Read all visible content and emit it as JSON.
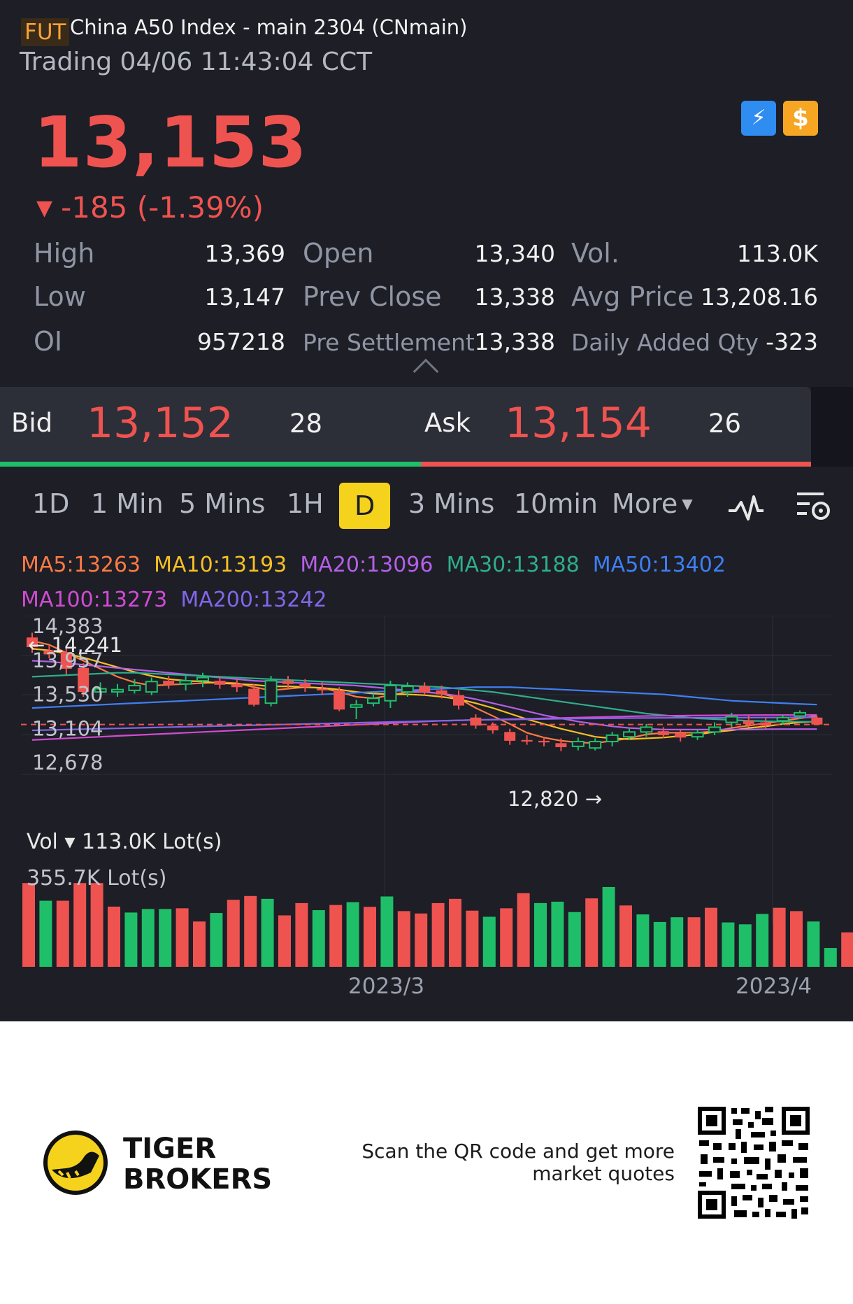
{
  "header": {
    "fut_tag": "FUT",
    "title": "China A50 Index - main 2304 (CNmain)",
    "status": "Trading 04/06 11:43:04 CCT",
    "price": "13,153",
    "change_arrow": "▼",
    "change": "-185 (-1.39%)",
    "badge_lightning": "⚡",
    "badge_dollar": "$"
  },
  "stats": {
    "high_label": "High",
    "high": "13,369",
    "low_label": "Low",
    "low": "13,147",
    "oi_label": "OI",
    "oi": "957218",
    "open_label": "Open",
    "open": "13,340",
    "prev_close_label": "Prev Close",
    "prev_close": "13,338",
    "pre_settlement_label": "Pre Settlement",
    "pre_settlement": "13,338",
    "vol_label": "Vol.",
    "vol": "113.0K",
    "avg_price_label": "Avg Price",
    "avg_price": "13,208.16",
    "daily_added_label": "Daily Added Qty",
    "daily_added": "-323"
  },
  "quote": {
    "bid_label": "Bid",
    "bid_price": "13,152",
    "bid_qty": "28",
    "ask_label": "Ask",
    "ask_price": "13,154",
    "ask_qty": "26"
  },
  "periods": [
    "1D",
    "1 Min",
    "5 Mins",
    "1H",
    "D",
    "3 Mins",
    "10min",
    "More"
  ],
  "active_period": "D",
  "ma": [
    {
      "label": "MA5:13263",
      "color": "#ff7a45"
    },
    {
      "label": "MA10:13193",
      "color": "#f6c025"
    },
    {
      "label": "MA20:13096",
      "color": "#b460e8"
    },
    {
      "label": "MA30:13188",
      "color": "#2fae8c"
    },
    {
      "label": "MA50:13402",
      "color": "#3f7ff5"
    },
    {
      "label": "MA100:13273",
      "color": "#d24bd3"
    },
    {
      "label": "MA200:13242",
      "color": "#8266e8"
    }
  ],
  "chart": {
    "y_ticks": [
      "14,383",
      "13,957",
      "13,530",
      "13,104",
      "12,678"
    ],
    "max_label": "← 14,241",
    "min_label": "12,820 →",
    "volume_title": "Vol ▾ 113.0K Lot(s)",
    "volume_max": "355.7K Lot(s)",
    "x_ticks": [
      "2023/3",
      "2023/4"
    ]
  },
  "chart_data": {
    "type": "candlestick",
    "y_range": [
      12678,
      14383
    ],
    "current_price": 13153,
    "candles": [
      {
        "o": 14241,
        "c": 14120,
        "h": 14300,
        "l": 14050
      },
      {
        "o": 14080,
        "c": 14030,
        "h": 14150,
        "l": 13980
      },
      {
        "o": 14060,
        "c": 13850,
        "h": 14120,
        "l": 13780
      },
      {
        "o": 13860,
        "c": 13560,
        "h": 13920,
        "l": 13500
      },
      {
        "o": 13560,
        "c": 13600,
        "h": 13680,
        "l": 13480
      },
      {
        "o": 13560,
        "c": 13590,
        "h": 13660,
        "l": 13500
      },
      {
        "o": 13580,
        "c": 13640,
        "h": 13720,
        "l": 13540
      },
      {
        "o": 13560,
        "c": 13690,
        "h": 13740,
        "l": 13520
      },
      {
        "o": 13700,
        "c": 13650,
        "h": 13760,
        "l": 13600
      },
      {
        "o": 13660,
        "c": 13700,
        "h": 13760,
        "l": 13580
      },
      {
        "o": 13700,
        "c": 13740,
        "h": 13800,
        "l": 13620
      },
      {
        "o": 13700,
        "c": 13650,
        "h": 13760,
        "l": 13600
      },
      {
        "o": 13660,
        "c": 13620,
        "h": 13720,
        "l": 13560
      },
      {
        "o": 13600,
        "c": 13400,
        "h": 13660,
        "l": 13380
      },
      {
        "o": 13420,
        "c": 13700,
        "h": 13760,
        "l": 13380
      },
      {
        "o": 13700,
        "c": 13660,
        "h": 13760,
        "l": 13600
      },
      {
        "o": 13660,
        "c": 13620,
        "h": 13720,
        "l": 13560
      },
      {
        "o": 13600,
        "c": 13580,
        "h": 13680,
        "l": 13520
      },
      {
        "o": 13580,
        "c": 13340,
        "h": 13620,
        "l": 13320
      },
      {
        "o": 13370,
        "c": 13400,
        "h": 13460,
        "l": 13220
      },
      {
        "o": 13420,
        "c": 13480,
        "h": 13540,
        "l": 13380
      },
      {
        "o": 13450,
        "c": 13640,
        "h": 13700,
        "l": 13360
      },
      {
        "o": 13560,
        "c": 13630,
        "h": 13680,
        "l": 13500
      },
      {
        "o": 13630,
        "c": 13560,
        "h": 13680,
        "l": 13520
      },
      {
        "o": 13580,
        "c": 13530,
        "h": 13640,
        "l": 13480
      },
      {
        "o": 13520,
        "c": 13390,
        "h": 13580,
        "l": 13340
      },
      {
        "o": 13240,
        "c": 13140,
        "h": 13280,
        "l": 13100
      },
      {
        "o": 13140,
        "c": 13080,
        "h": 13180,
        "l": 13040
      },
      {
        "o": 13060,
        "c": 12950,
        "h": 13100,
        "l": 12900
      },
      {
        "o": 12960,
        "c": 12940,
        "h": 13020,
        "l": 12900
      },
      {
        "o": 12950,
        "c": 12930,
        "h": 13000,
        "l": 12880
      },
      {
        "o": 12920,
        "c": 12870,
        "h": 12980,
        "l": 12820
      },
      {
        "o": 12880,
        "c": 12940,
        "h": 12990,
        "l": 12830
      },
      {
        "o": 12860,
        "c": 12940,
        "h": 12980,
        "l": 12830
      },
      {
        "o": 12940,
        "c": 13020,
        "h": 13060,
        "l": 12880
      },
      {
        "o": 13000,
        "c": 13060,
        "h": 13100,
        "l": 12960
      },
      {
        "o": 13060,
        "c": 13120,
        "h": 13160,
        "l": 13000
      },
      {
        "o": 13070,
        "c": 13020,
        "h": 13120,
        "l": 12980
      },
      {
        "o": 13040,
        "c": 12990,
        "h": 13090,
        "l": 12940
      },
      {
        "o": 13000,
        "c": 13050,
        "h": 13090,
        "l": 12960
      },
      {
        "o": 13060,
        "c": 13120,
        "h": 13180,
        "l": 13020
      },
      {
        "o": 13180,
        "c": 13250,
        "h": 13300,
        "l": 13120
      },
      {
        "o": 13200,
        "c": 13160,
        "h": 13260,
        "l": 13120
      },
      {
        "o": 13180,
        "c": 13140,
        "h": 13240,
        "l": 13100
      },
      {
        "o": 13200,
        "c": 13240,
        "h": 13270,
        "l": 13150
      },
      {
        "o": 13260,
        "c": 13300,
        "h": 13330,
        "l": 13220
      },
      {
        "o": 13240,
        "c": 13153,
        "h": 13260,
        "l": 13147
      }
    ],
    "volume_max": 355.7,
    "volumes": [
      {
        "v": 355,
        "d": "down"
      },
      {
        "v": 280,
        "d": "up"
      },
      {
        "v": 280,
        "d": "down"
      },
      {
        "v": 355,
        "d": "down"
      },
      {
        "v": 355,
        "d": "down"
      },
      {
        "v": 255,
        "d": "down"
      },
      {
        "v": 230,
        "d": "up"
      },
      {
        "v": 245,
        "d": "up"
      },
      {
        "v": 245,
        "d": "up"
      },
      {
        "v": 248,
        "d": "down"
      },
      {
        "v": 192,
        "d": "down"
      },
      {
        "v": 228,
        "d": "up"
      },
      {
        "v": 284,
        "d": "down"
      },
      {
        "v": 300,
        "d": "down"
      },
      {
        "v": 288,
        "d": "up"
      },
      {
        "v": 218,
        "d": "down"
      },
      {
        "v": 270,
        "d": "down"
      },
      {
        "v": 240,
        "d": "up"
      },
      {
        "v": 262,
        "d": "down"
      },
      {
        "v": 274,
        "d": "up"
      },
      {
        "v": 254,
        "d": "down"
      },
      {
        "v": 298,
        "d": "up"
      },
      {
        "v": 236,
        "d": "down"
      },
      {
        "v": 226,
        "d": "down"
      },
      {
        "v": 270,
        "d": "down"
      },
      {
        "v": 288,
        "d": "down"
      },
      {
        "v": 238,
        "d": "down"
      },
      {
        "v": 212,
        "d": "up"
      },
      {
        "v": 248,
        "d": "down"
      },
      {
        "v": 312,
        "d": "down"
      },
      {
        "v": 270,
        "d": "up"
      },
      {
        "v": 276,
        "d": "up"
      },
      {
        "v": 232,
        "d": "up"
      },
      {
        "v": 290,
        "d": "down"
      },
      {
        "v": 338,
        "d": "up"
      },
      {
        "v": 260,
        "d": "down"
      },
      {
        "v": 222,
        "d": "up"
      },
      {
        "v": 190,
        "d": "up"
      },
      {
        "v": 210,
        "d": "up"
      },
      {
        "v": 210,
        "d": "down"
      },
      {
        "v": 250,
        "d": "down"
      },
      {
        "v": 188,
        "d": "up"
      },
      {
        "v": 180,
        "d": "up"
      },
      {
        "v": 224,
        "d": "up"
      },
      {
        "v": 250,
        "d": "down"
      },
      {
        "v": 236,
        "d": "down"
      },
      {
        "v": 192,
        "d": "up"
      },
      {
        "v": 80,
        "d": "up"
      },
      {
        "v": 146,
        "d": "down"
      }
    ],
    "ma_lines": [
      {
        "name": "MA5",
        "values": [
          14200,
          14150,
          14050,
          13950,
          13850,
          13750,
          13680,
          13640,
          13650,
          13660,
          13670,
          13680,
          13670,
          13620,
          13580,
          13600,
          13620,
          13610,
          13560,
          13500,
          13480,
          13520,
          13560,
          13560,
          13540,
          13480,
          13360,
          13260,
          13160,
          13050,
          12990,
          12950,
          12930,
          12920,
          12950,
          12980,
          13030,
          13050,
          13050,
          13050,
          13070,
          13110,
          13140,
          13170,
          13200,
          13230,
          13263
        ]
      },
      {
        "name": "MA10",
        "values": [
          14100,
          14080,
          14040,
          13990,
          13930,
          13870,
          13810,
          13760,
          13720,
          13700,
          13690,
          13670,
          13660,
          13650,
          13630,
          13630,
          13620,
          13610,
          13590,
          13560,
          13540,
          13530,
          13530,
          13520,
          13500,
          13470,
          13420,
          13360,
          13290,
          13220,
          13160,
          13100,
          13050,
          13000,
          12980,
          12970,
          12980,
          12990,
          13010,
          13030,
          13060,
          13080,
          13110,
          13130,
          13160,
          13180,
          13193
        ]
      },
      {
        "name": "MA20",
        "values": [
          13950,
          13940,
          13920,
          13900,
          13880,
          13860,
          13840,
          13820,
          13800,
          13780,
          13760,
          13740,
          13720,
          13700,
          13690,
          13680,
          13670,
          13660,
          13650,
          13640,
          13620,
          13600,
          13580,
          13560,
          13540,
          13510,
          13470,
          13420,
          13370,
          13320,
          13270,
          13230,
          13190,
          13160,
          13130,
          13110,
          13100,
          13090,
          13090,
          13090,
          13090,
          13090,
          13090,
          13095,
          13096,
          13096,
          13096
        ]
      },
      {
        "name": "MA30",
        "values": [
          13750,
          13760,
          13770,
          13780,
          13790,
          13800,
          13800,
          13790,
          13780,
          13770,
          13760,
          13750,
          13740,
          13730,
          13720,
          13710,
          13700,
          13690,
          13680,
          13670,
          13660,
          13650,
          13640,
          13630,
          13620,
          13600,
          13580,
          13560,
          13530,
          13500,
          13470,
          13440,
          13410,
          13380,
          13350,
          13320,
          13290,
          13270,
          13250,
          13230,
          13220,
          13210,
          13200,
          13195,
          13190,
          13189,
          13188
        ]
      },
      {
        "name": "MA50",
        "values": [
          13360,
          13370,
          13380,
          13390,
          13400,
          13410,
          13420,
          13430,
          13440,
          13450,
          13460,
          13470,
          13480,
          13490,
          13500,
          13510,
          13520,
          13530,
          13540,
          13550,
          13560,
          13570,
          13580,
          13590,
          13600,
          13610,
          13620,
          13620,
          13620,
          13610,
          13600,
          13590,
          13580,
          13570,
          13560,
          13550,
          13540,
          13530,
          13510,
          13490,
          13470,
          13450,
          13440,
          13430,
          13420,
          13410,
          13402
        ]
      },
      {
        "name": "MA100",
        "values": [
          12960,
          12970,
          12980,
          12990,
          13000,
          13010,
          13020,
          13030,
          13040,
          13050,
          13060,
          13070,
          13080,
          13090,
          13100,
          13110,
          13120,
          13130,
          13140,
          13150,
          13160,
          13170,
          13180,
          13190,
          13200,
          13205,
          13210,
          13215,
          13220,
          13225,
          13230,
          13235,
          13240,
          13245,
          13250,
          13255,
          13260,
          13262,
          13264,
          13266,
          13268,
          13270,
          13271,
          13272,
          13272,
          13273,
          13273
        ]
      },
      {
        "name": "MA200",
        "values": [
          13080,
          13085,
          13090,
          13095,
          13100,
          13105,
          13110,
          13115,
          13120,
          13125,
          13130,
          13135,
          13140,
          13145,
          13150,
          13155,
          13160,
          13165,
          13170,
          13175,
          13180,
          13185,
          13190,
          13195,
          13200,
          13205,
          13210,
          13213,
          13216,
          13219,
          13222,
          13225,
          13227,
          13229,
          13231,
          13233,
          13235,
          13236,
          13237,
          13238,
          13239,
          13240,
          13240,
          13241,
          13241,
          13242,
          13242
        ]
      }
    ]
  },
  "footer": {
    "brand": "TIGER\nBROKERS",
    "qr_text": "Scan the QR code and get more market quotes"
  }
}
